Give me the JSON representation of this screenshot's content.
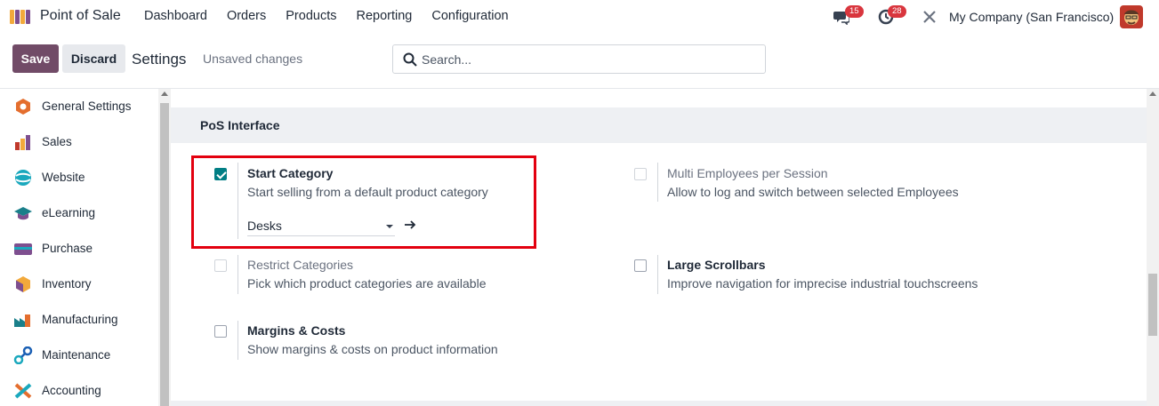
{
  "nav": {
    "app_name": "Point of Sale",
    "menu": [
      "Dashboard",
      "Orders",
      "Products",
      "Reporting",
      "Configuration"
    ],
    "messages_count": "15",
    "activities_count": "28",
    "company": "My Company (San Francisco)"
  },
  "control": {
    "save_label": "Save",
    "discard_label": "Discard",
    "title": "Settings",
    "status": "Unsaved changes",
    "search_placeholder": "Search..."
  },
  "sidebar": {
    "items": [
      {
        "label": "General Settings",
        "icon": "general-settings-icon"
      },
      {
        "label": "Sales",
        "icon": "sales-icon"
      },
      {
        "label": "Website",
        "icon": "website-icon"
      },
      {
        "label": "eLearning",
        "icon": "elearning-icon"
      },
      {
        "label": "Purchase",
        "icon": "purchase-icon"
      },
      {
        "label": "Inventory",
        "icon": "inventory-icon"
      },
      {
        "label": "Manufacturing",
        "icon": "manufacturing-icon"
      },
      {
        "label": "Maintenance",
        "icon": "maintenance-icon"
      },
      {
        "label": "Accounting",
        "icon": "accounting-icon"
      }
    ]
  },
  "section": {
    "title": "PoS Interface",
    "settings": {
      "start_category": {
        "title": "Start Category",
        "desc": "Start selling from a default product category",
        "checked": true,
        "value": "Desks"
      },
      "multi_employees": {
        "title": "Multi Employees per Session",
        "desc": "Allow to log and switch between selected Employees",
        "checked": false,
        "disabled": true
      },
      "restrict_categories": {
        "title": "Restrict Categories",
        "desc": "Pick which product categories are available",
        "checked": false,
        "disabled": true
      },
      "large_scrollbars": {
        "title": "Large Scrollbars",
        "desc": "Improve navigation for imprecise industrial touchscreens",
        "checked": false
      },
      "margins_costs": {
        "title": "Margins & Costs",
        "desc": "Show margins & costs on product information",
        "checked": false
      }
    }
  },
  "colors": {
    "brand": "#714b67",
    "checkbox": "#017e84",
    "highlight": "#e3000f",
    "badge": "#d9363e"
  }
}
